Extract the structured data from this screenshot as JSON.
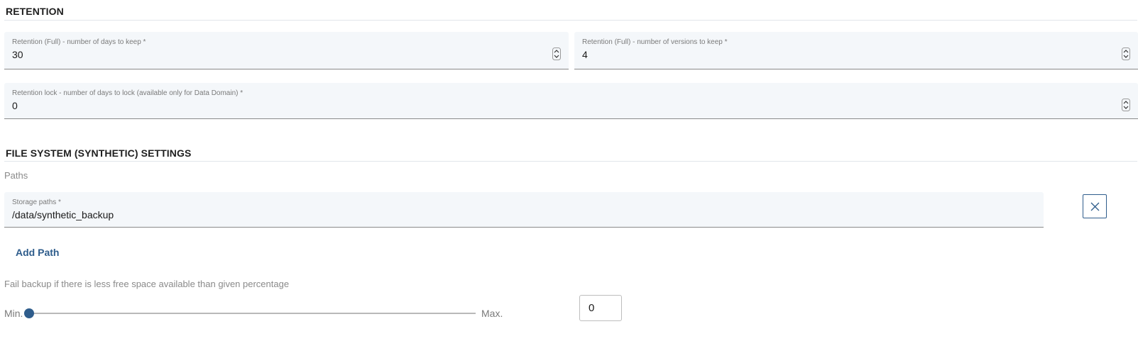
{
  "retention": {
    "header": "RETENTION",
    "full_days": {
      "label": "Retention (Full) - number of days to keep *",
      "value": "30"
    },
    "full_versions": {
      "label": "Retention (Full) - number of versions to keep *",
      "value": "4"
    },
    "lock_days": {
      "label": "Retention lock - number of days to lock (available only for Data Domain) *",
      "value": "0"
    }
  },
  "filesystem": {
    "header": "FILE SYSTEM (SYNTHETIC) SETTINGS",
    "paths_label": "Paths",
    "storage_paths": {
      "label": "Storage paths *",
      "value": "/data/synthetic_backup"
    },
    "remove_icon": "close-icon",
    "add_path_label": "Add Path",
    "fail_backup_text": "Fail backup if there is less free space available than given percentage",
    "slider": {
      "min_label": "Min.",
      "max_label": "Max.",
      "value": 0
    },
    "percentage_value": "0"
  },
  "colors": {
    "accent": "#2f5d8c",
    "field_bg": "#f4f7fa"
  }
}
